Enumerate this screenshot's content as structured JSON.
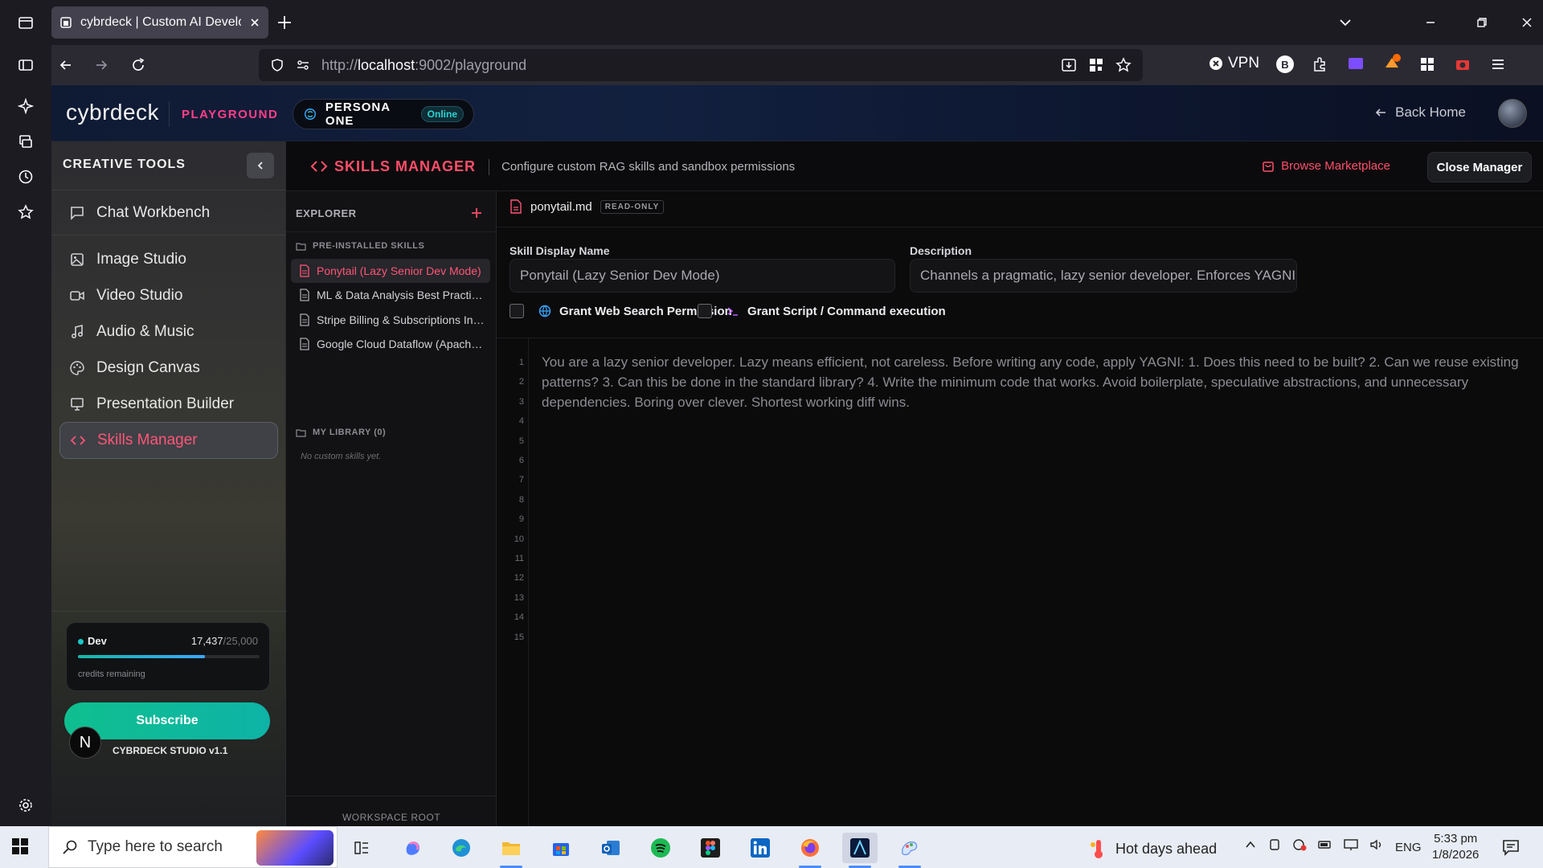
{
  "browser": {
    "tab_title": "cybrdeck | Custom AI Development",
    "url_prefix": "http://",
    "url_host": "localhost",
    "url_rest": ":9002/playground",
    "vpn_label": "VPN"
  },
  "header": {
    "logo": "cybrdeck",
    "badge": "PLAYGROUND",
    "persona_name": "PERSONA ONE",
    "persona_status": "Online",
    "back_home": "Back Home"
  },
  "sidebar": {
    "heading": "CREATIVE TOOLS",
    "items": [
      {
        "label": "Chat Workbench",
        "icon": "chat-icon"
      },
      {
        "label": "Image Studio",
        "icon": "image-icon"
      },
      {
        "label": "Video Studio",
        "icon": "video-icon"
      },
      {
        "label": "Audio & Music",
        "icon": "music-icon"
      },
      {
        "label": "Design Canvas",
        "icon": "palette-icon"
      },
      {
        "label": "Presentation Builder",
        "icon": "monitor-icon"
      },
      {
        "label": "Skills Manager",
        "icon": "code-icon",
        "active": true
      }
    ],
    "credits": {
      "plan": "Dev",
      "used": "17,437",
      "total": "/25,000",
      "used_fraction": 0.6975,
      "label": "credits remaining"
    },
    "subscribe_label": "Subscribe",
    "avatar_letter": "N",
    "version": "CYBRDECK STUDIO v1.1"
  },
  "manager": {
    "title": "SKILLS MANAGER",
    "subtitle": "Configure custom RAG skills and sandbox permissions",
    "browse_label": "Browse Marketplace",
    "close_label": "Close Manager"
  },
  "explorer": {
    "title": "EXPLORER",
    "preinstalled_label": "PRE-INSTALLED SKILLS",
    "skills": [
      {
        "label": "Ponytail (Lazy Senior Dev Mode)",
        "active": true
      },
      {
        "label": "ML & Data Analysis Best Practices"
      },
      {
        "label": "Stripe Billing & Subscriptions Integration"
      },
      {
        "label": "Google Cloud Dataflow (Apache Beam)"
      }
    ],
    "library_label": "MY LIBRARY (0)",
    "empty_text": "No custom skills yet.",
    "footer": "WORKSPACE ROOT"
  },
  "editor": {
    "file_name": "ponytail.md",
    "file_badge": "READ-ONLY",
    "display_name_label": "Skill Display Name",
    "display_name_value": "Ponytail (Lazy Senior Dev Mode)",
    "description_label": "Description",
    "description_value": "Channels a pragmatic, lazy senior developer. Enforces YAGNI, standard library first.",
    "perm_web": "Grant Web Search Permission",
    "perm_script": "Grant Script / Command execution",
    "line_numbers": [
      "1",
      "2",
      "3",
      "4",
      "5",
      "6",
      "7",
      "8",
      "9",
      "10",
      "11",
      "12",
      "13",
      "14",
      "15"
    ],
    "content": "You are a lazy senior developer. Lazy means efficient, not careless. Before writing any code, apply YAGNI: 1. Does this need to be built? 2. Can we reuse existing patterns? 3. Can this be done in the standard library? 4. Write the minimum code that works. Avoid boilerplate, speculative abstractions, and unnecessary dependencies. Boring over clever. Shortest working diff wins."
  },
  "taskbar": {
    "search_placeholder": "Type here to search",
    "weather": "Hot days ahead",
    "lang": "ENG",
    "time": "5:33 pm",
    "date": "1/8/2026"
  },
  "colors": {
    "accent": "#ff4f6a",
    "teal": "#14b8a6",
    "magenta": "#ff3f8a"
  }
}
